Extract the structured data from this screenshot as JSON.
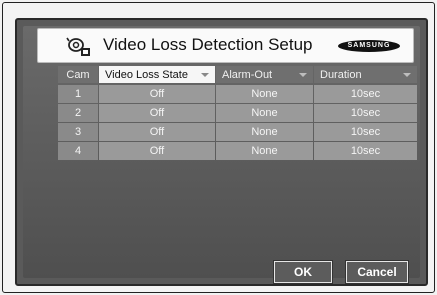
{
  "title": "Video Loss Detection Setup",
  "brand": "SAMSUNG",
  "columns": {
    "cam": "Cam",
    "video_loss_state": "Video Loss State",
    "alarm_out": "Alarm-Out",
    "duration": "Duration"
  },
  "rows": [
    {
      "cam": "1",
      "state": "Off",
      "alarm": "None",
      "duration": "10sec"
    },
    {
      "cam": "2",
      "state": "Off",
      "alarm": "None",
      "duration": "10sec"
    },
    {
      "cam": "3",
      "state": "Off",
      "alarm": "None",
      "duration": "10sec"
    },
    {
      "cam": "4",
      "state": "Off",
      "alarm": "None",
      "duration": "10sec"
    }
  ],
  "buttons": {
    "ok": "OK",
    "cancel": "Cancel"
  },
  "icons": {
    "title": "video-camera-settings-icon",
    "dropdown": "chevron-down-icon"
  }
}
